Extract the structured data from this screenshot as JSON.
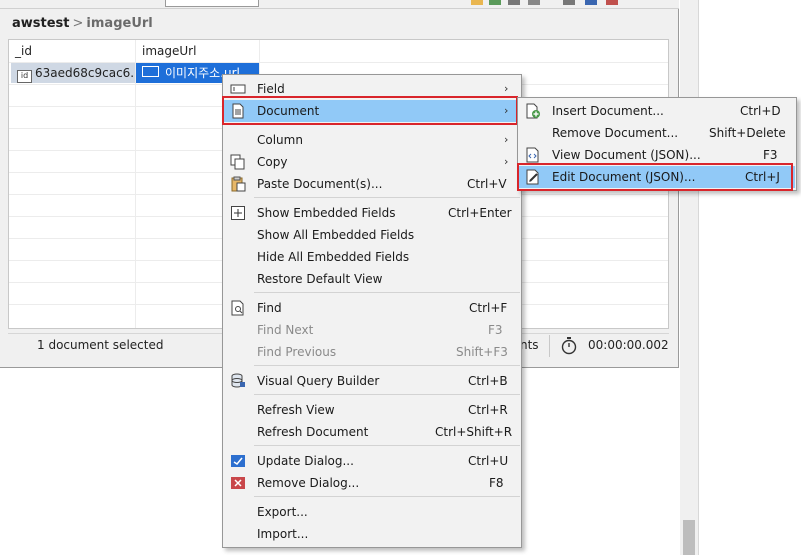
{
  "breadcrumb": {
    "db": "awstest",
    "sep": ">",
    "collection": "imageUrl"
  },
  "grid": {
    "columns": [
      "_id",
      "imageUrl"
    ],
    "row": {
      "id_value": "63aed68c9cac6...",
      "id_badge": "id",
      "url_value": "이미지주소.url"
    }
  },
  "status": {
    "selected": "1 document selected",
    "partial": "nts",
    "time": "00:00:00.002"
  },
  "context_menu": {
    "field": {
      "label": "Field",
      "arrow": "›"
    },
    "document": {
      "label": "Document",
      "arrow": "›"
    },
    "column": {
      "label": "Column",
      "arrow": "›"
    },
    "copy": {
      "label": "Copy",
      "arrow": "›"
    },
    "paste": {
      "label": "Paste Document(s)...",
      "shortcut": "Ctrl+V"
    },
    "show_embedded": {
      "label": "Show Embedded Fields",
      "shortcut": "Ctrl+Enter"
    },
    "show_all_embedded": {
      "label": "Show All Embedded Fields"
    },
    "hide_all_embedded": {
      "label": "Hide All Embedded Fields"
    },
    "restore_view": {
      "label": "Restore Default View"
    },
    "find": {
      "label": "Find",
      "shortcut": "Ctrl+F"
    },
    "find_next": {
      "label": "Find Next",
      "shortcut": "F3"
    },
    "find_previous": {
      "label": "Find Previous",
      "shortcut": "Shift+F3"
    },
    "visual_query": {
      "label": "Visual Query Builder",
      "shortcut": "Ctrl+B"
    },
    "refresh_view": {
      "label": "Refresh View",
      "shortcut": "Ctrl+R"
    },
    "refresh_document": {
      "label": "Refresh Document",
      "shortcut": "Ctrl+Shift+R"
    },
    "update_dialog": {
      "label": "Update Dialog...",
      "shortcut": "Ctrl+U"
    },
    "remove_dialog": {
      "label": "Remove Dialog...",
      "shortcut": "F8"
    },
    "export": {
      "label": "Export..."
    },
    "import": {
      "label": "Import..."
    }
  },
  "submenu": {
    "insert": {
      "label": "Insert Document...",
      "shortcut": "Ctrl+D"
    },
    "remove": {
      "label": "Remove Document...",
      "shortcut": "Shift+Delete"
    },
    "view_json": {
      "label": "View Document (JSON)...",
      "shortcut": "F3"
    },
    "edit_json": {
      "label": "Edit Document (JSON)...",
      "shortcut": "Ctrl+J"
    }
  },
  "colors": {
    "highlight": "#91c9f7",
    "selection": "#1e6fd9",
    "annotation": "#d9252b"
  }
}
